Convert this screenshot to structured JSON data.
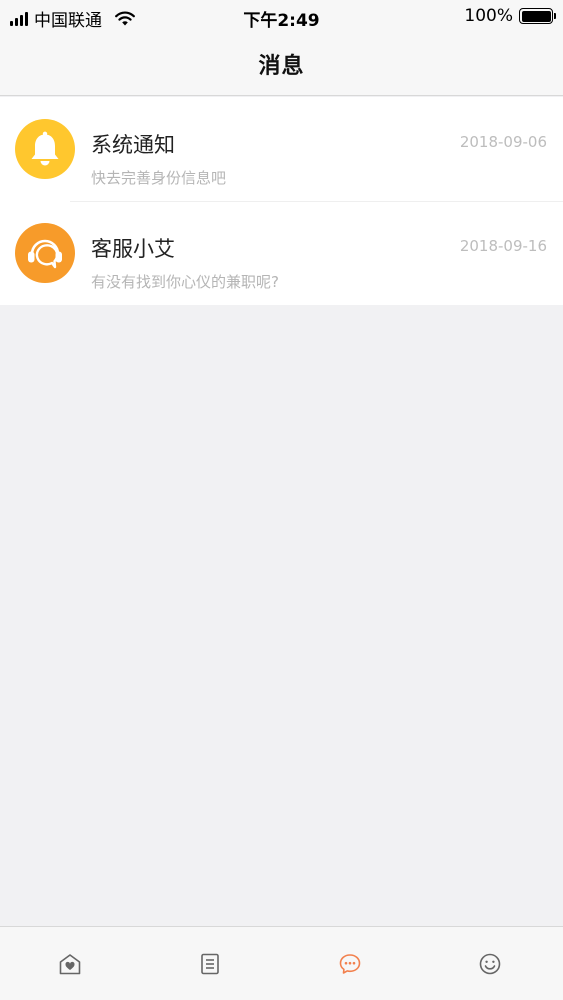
{
  "status_bar": {
    "carrier": "中国联通",
    "time": "下午2:49",
    "battery_text": "100%",
    "battery_level": 1.0,
    "icons": [
      "signal-icon",
      "wifi-icon",
      "battery-icon"
    ]
  },
  "nav": {
    "title": "消息"
  },
  "messages": [
    {
      "title": "系统通知",
      "subtitle": "快去完善身份信息吧",
      "date": "2018-09-06",
      "icon": "bell-icon",
      "color": "#ffc72e"
    },
    {
      "title": "客服小艾",
      "subtitle": "有没有找到你心仪的兼职呢?",
      "date": "2018-09-16",
      "icon": "headset-icon",
      "color": "#f79b2a"
    }
  ],
  "tab_bar": {
    "tabs": [
      {
        "icon": "home-icon",
        "active": false
      },
      {
        "icon": "document-icon",
        "active": false
      },
      {
        "icon": "message-icon",
        "active": true
      },
      {
        "icon": "profile-smile-icon",
        "active": false
      }
    ],
    "active_color": "#f2804d",
    "inactive_color": "#666666"
  }
}
